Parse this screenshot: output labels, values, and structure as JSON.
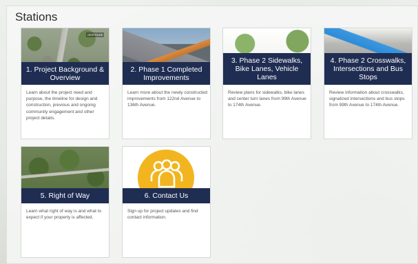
{
  "page": {
    "title": "Stations"
  },
  "stations": [
    {
      "label": "1. Project Background & Overview",
      "description": "Learn about the project need and purpose, the timeline for design and construction, previous and ongoing community engagement and other project details.",
      "image": "aerial-map-image",
      "tag": "GERTRUDE"
    },
    {
      "label": "2. Phase 1 Completed Improvements",
      "description": "Learn more about the newly constructed improvements from 122nd Avenue to 136th Avenue.",
      "image": "road-photo-image"
    },
    {
      "label": "3. Phase 2 Sidewalks, Bike Lanes, Vehicle Lanes",
      "description": "Review plans for sidewalks, bike lanes and center turn lanes from 99th Avenue to 174th Avenue.",
      "image": "street-rendering-image"
    },
    {
      "label": "4. Phase 2 Crosswalks, Intersections and Bus Stops",
      "description": "Review information about crosswalks, signalized intersections and bus stops from 99th Avenue to 174th Avenue.",
      "image": "bus-rendering-image"
    },
    {
      "label": "5. Right of Way",
      "description": "Learn what right of way is and what to expect if your property is affected.",
      "image": "aerial-neighborhood-image"
    },
    {
      "label": "6. Contact Us",
      "description": "Sign up for project updates and find contact information.",
      "image": "people-group-icon"
    }
  ],
  "colors": {
    "label_bg": "#1f2d52",
    "contact_circle": "#f2b520"
  }
}
